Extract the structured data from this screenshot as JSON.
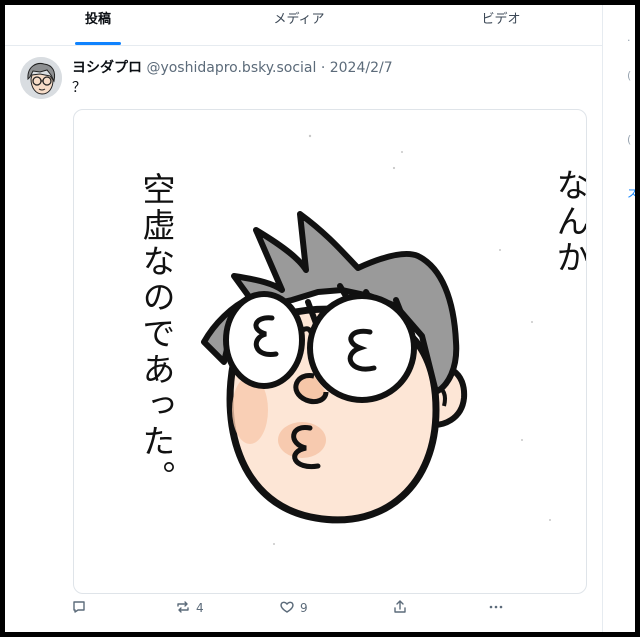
{
  "tabs": [
    {
      "label": "投稿",
      "active": true
    },
    {
      "label": "メディア",
      "active": false
    },
    {
      "label": "ビデオ",
      "active": false
    }
  ],
  "post": {
    "author_name": "ヨシダプロ",
    "handle": "@yoshidapro.bsky.social",
    "separator": "·",
    "date": "2024/2/7",
    "text": "？",
    "image": {
      "text_left": "空虚なのであった。",
      "text_right": "なんか"
    },
    "actions": {
      "reply_icon": "reply-icon",
      "repost_icon": "repost-icon",
      "repost_count": "4",
      "like_icon": "heart-icon",
      "like_count": "9",
      "share_icon": "share-icon",
      "more_icon": "more-icon"
    }
  },
  "colors": {
    "accent": "#1083fe",
    "text": "#0b0f14",
    "muted": "#5c6b7a",
    "border": "#e6ebf0"
  }
}
